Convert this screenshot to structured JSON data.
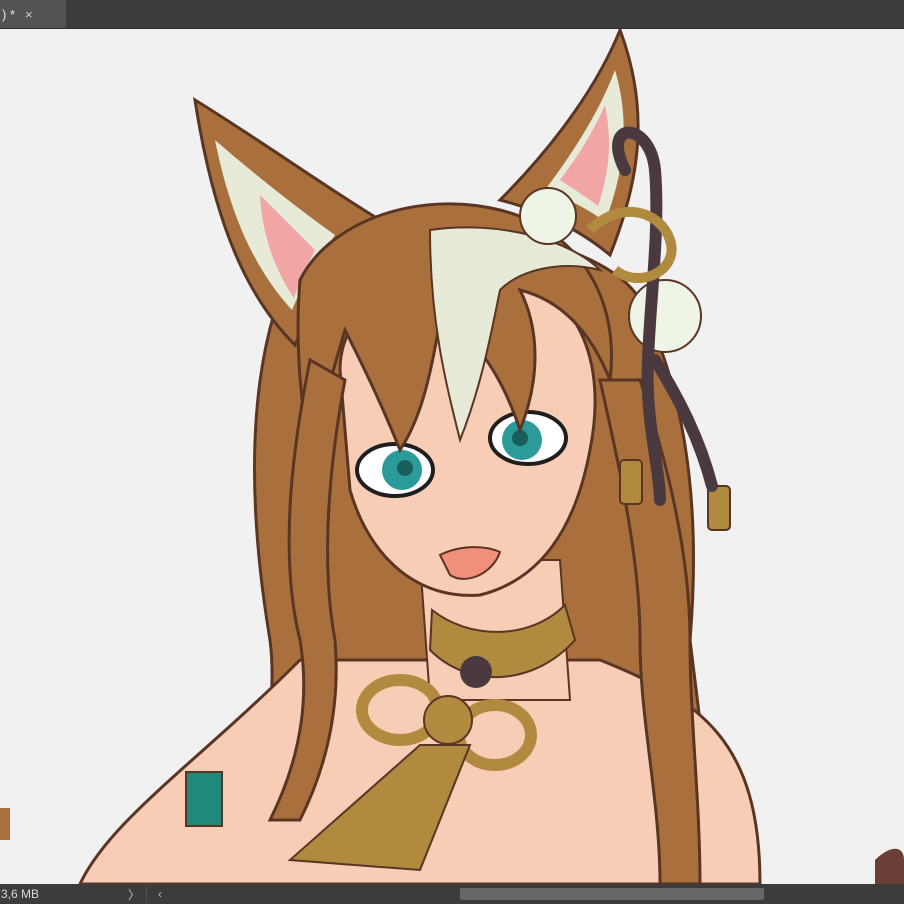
{
  "document_tab": {
    "title": ") *",
    "close_glyph": "×"
  },
  "status": {
    "doc_size": "3,6 MB",
    "scroll_right_glyph": "〉",
    "scroll_left_glyph": "‹"
  },
  "canvas": {
    "background": "#f1f1f1",
    "content": "fox-girl-illustration"
  },
  "colors": {
    "chrome": "#3c3c3c",
    "tab": "#535353",
    "hair": "#a9703d",
    "hair_light": "#e6ead6",
    "skin": "#f7cdb5",
    "outline": "#5a3524",
    "eye": "#2a9b98",
    "ribbon": "#4a3a3f",
    "gold": "#b08a3f"
  }
}
